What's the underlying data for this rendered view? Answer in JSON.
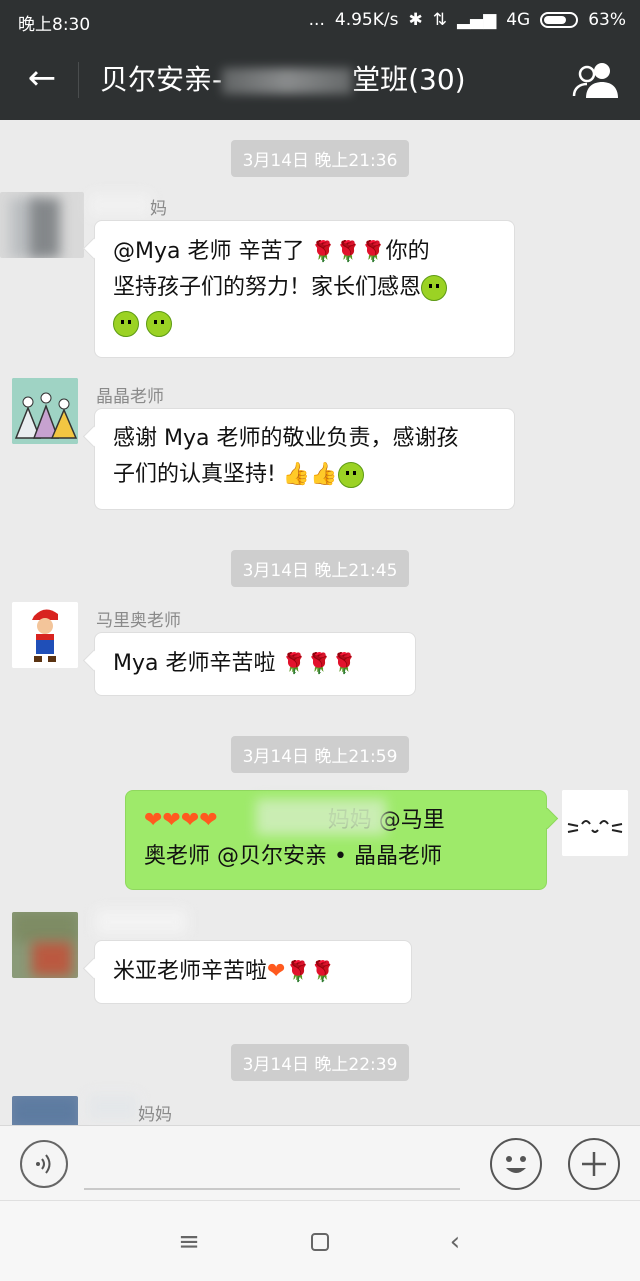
{
  "status_bar": {
    "time": "晚上8:30",
    "dots": "...",
    "speed": "4.95K/s",
    "network": "4G",
    "battery": "63%"
  },
  "header": {
    "title_prefix": "贝尔安亲-",
    "title_suffix": "堂班(30)"
  },
  "messages": {
    "ts1": "3月14日 晚上21:36",
    "m1_name": "妈",
    "m1_line1": "@Mya 老师  辛苦了",
    "m1_line1_tail": "你的",
    "m1_line2": "坚持孩子们的努力！家长们感恩",
    "m2_name": "晶晶老师",
    "m2_line1": "感谢 Mya 老师的敬业负责，感谢孩",
    "m2_line2": "子们的认真坚持!",
    "ts2": "3月14日 晚上21:45",
    "m3_name": "马里奥老师",
    "m3_text": "Mya 老师辛苦啦",
    "ts3": "3月14日 晚上21:59",
    "m4_line1_tail": "妈妈  @马里",
    "m4_line2": "奥老师  @贝尔安亲 • 晶晶老师",
    "m5_text": "米亚老师辛苦啦",
    "ts4": "3月14日 晚上22:39",
    "m6_name": "妈妈"
  },
  "colors": {
    "header_bg": "#2e3132",
    "chat_bg": "#ebebeb",
    "my_bubble": "#9eea6a",
    "their_bubble": "#ffffff"
  },
  "icons": [
    "back-arrow-icon",
    "group-members-icon",
    "voice-icon",
    "emoji-icon",
    "plus-icon",
    "menu-icon",
    "home-icon",
    "nav-back-icon",
    "bluetooth-icon",
    "signal-icon",
    "battery-icon"
  ]
}
